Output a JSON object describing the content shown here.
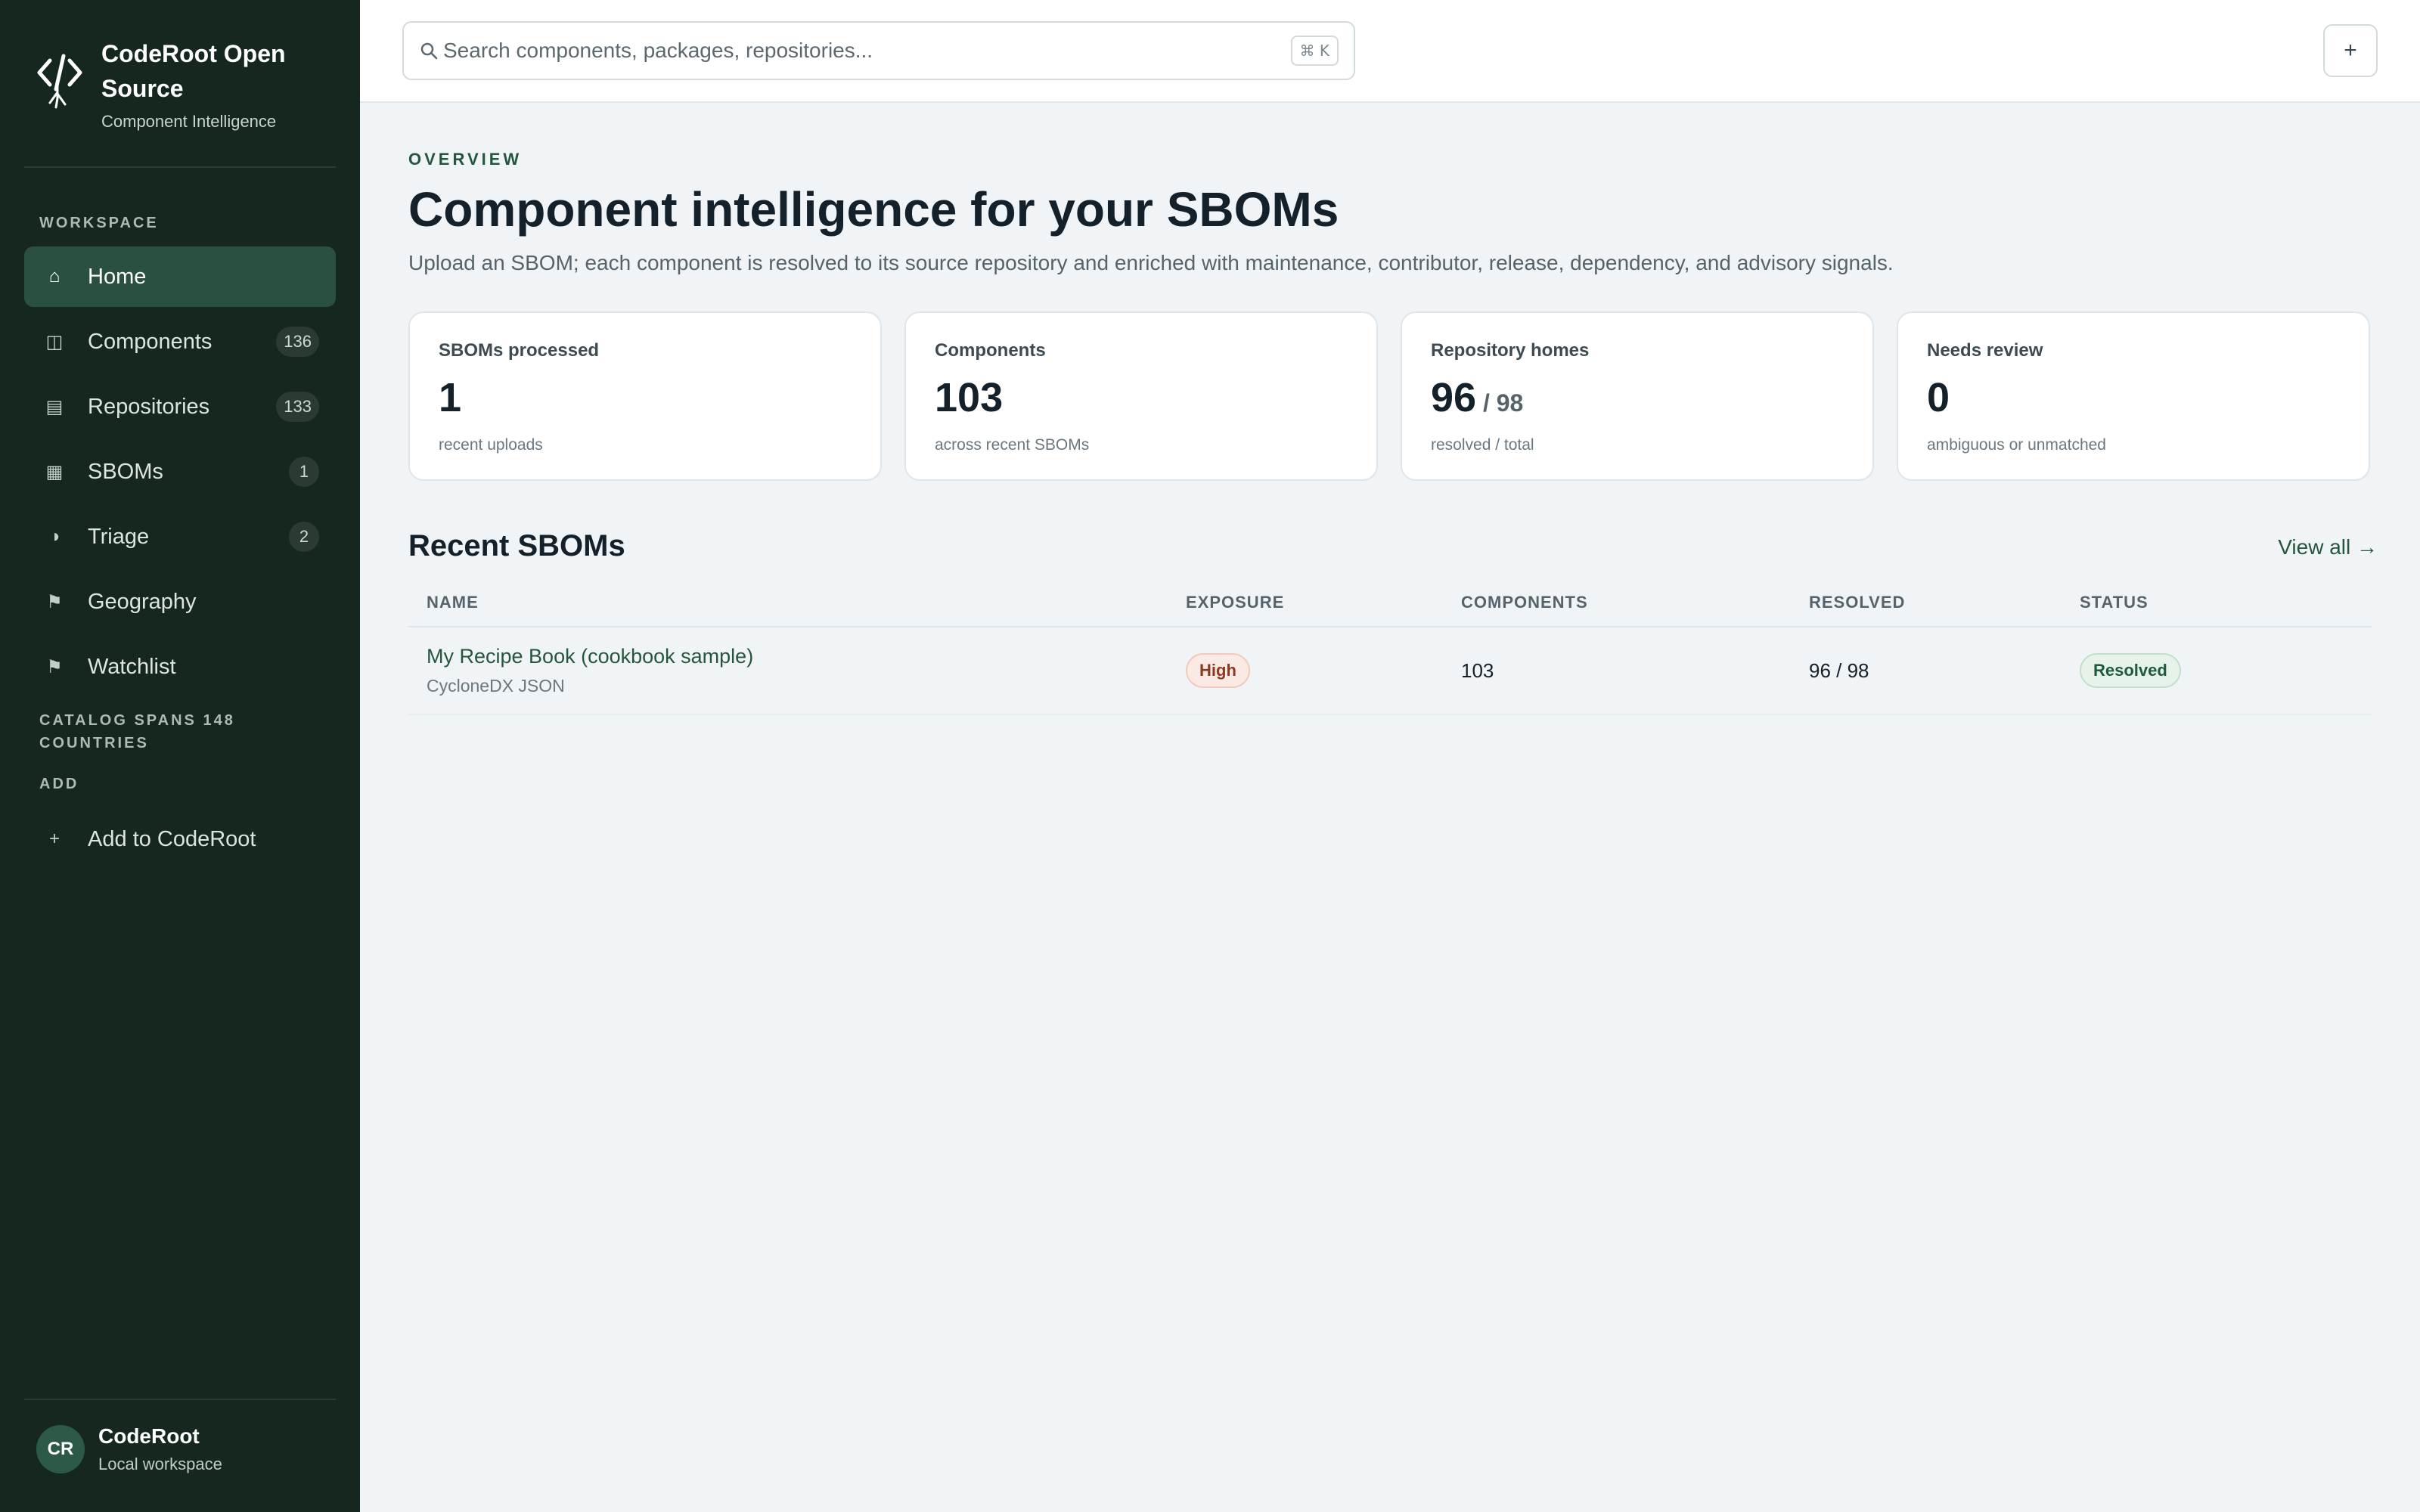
{
  "brand": {
    "name": "CodeRoot Open Source",
    "subtitle": "Component Intelligence"
  },
  "sidebar": {
    "workspace_label": "WORKSPACE",
    "items": [
      {
        "label": "Home",
        "icon": "home-icon",
        "active": true
      },
      {
        "label": "Components",
        "icon": "components-icon",
        "count": "136"
      },
      {
        "label": "Repositories",
        "icon": "repositories-icon",
        "count": "133"
      },
      {
        "label": "SBOMs",
        "icon": "sboms-icon",
        "count": "1"
      },
      {
        "label": "Triage",
        "icon": "triage-icon",
        "count": "2"
      },
      {
        "label": "Geography",
        "icon": "flag-icon"
      },
      {
        "label": "Watchlist",
        "icon": "flag-icon"
      }
    ],
    "catalog_note": "CATALOG SPANS 148 COUNTRIES",
    "add_label": "ADD",
    "add_item": "Add to CodeRoot"
  },
  "user": {
    "initials": "CR",
    "name": "CodeRoot",
    "workspace": "Local workspace"
  },
  "search": {
    "placeholder": "Search components, packages, repositories...",
    "shortcut": "⌘ K"
  },
  "top_action": "+",
  "overview": {
    "eyebrow": "OVERVIEW",
    "title": "Component intelligence for your SBOMs",
    "description": "Upload an SBOM; each component is resolved to its source repository and enriched with maintenance, contributor, release, dependency, and advisory signals."
  },
  "stats": [
    {
      "label": "SBOMs processed",
      "value": "1",
      "suffix": "",
      "sub": "recent uploads"
    },
    {
      "label": "Components",
      "value": "103",
      "suffix": "",
      "sub": "across recent SBOMs"
    },
    {
      "label": "Repository homes",
      "value": "96",
      "suffix": " / 98",
      "sub": "resolved / total"
    },
    {
      "label": "Needs review",
      "value": "0",
      "suffix": "",
      "sub": "ambiguous or unmatched"
    }
  ],
  "recent": {
    "title": "Recent SBOMs",
    "view_all": "View all →",
    "columns": [
      "NAME",
      "EXPOSURE",
      "COMPONENTS",
      "RESOLVED",
      "STATUS"
    ],
    "rows": [
      {
        "name": "My Recipe Book (cookbook sample)",
        "format": "CycloneDX JSON",
        "exposure": "High",
        "components": "103",
        "resolved": "96 / 98",
        "status": "Resolved"
      }
    ]
  }
}
